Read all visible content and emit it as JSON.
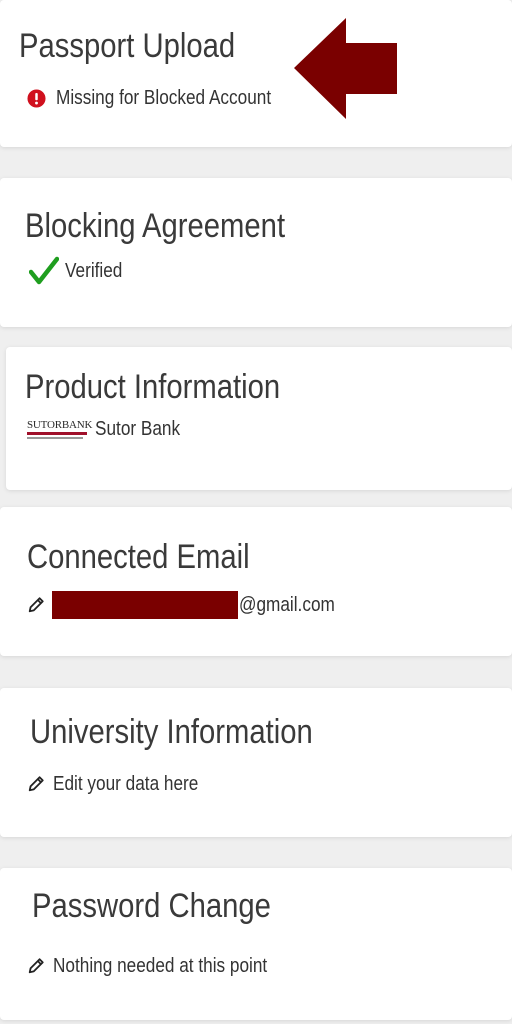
{
  "colors": {
    "error_red": "#d0101e",
    "verified_green": "#1f9e1f",
    "arrow_maroon": "#7a0000",
    "redaction_maroon": "#7a0000",
    "logo_red": "#a0102a"
  },
  "cards": {
    "passport": {
      "title": "Passport Upload",
      "status_icon": "error-circle-icon",
      "status": "Missing for Blocked Account"
    },
    "blocking": {
      "title": "Blocking Agreement",
      "status_icon": "checkmark-icon",
      "status": "Verified"
    },
    "product": {
      "title": "Product Information",
      "logo_text": "SUTORBANK",
      "bank_name": "Sutor Bank"
    },
    "email": {
      "title": "Connected Email",
      "status_icon": "pencil-icon",
      "email_domain": "@gmail.com"
    },
    "university": {
      "title": "University Information",
      "status_icon": "pencil-icon",
      "status": "Edit your data here"
    },
    "password": {
      "title": "Password Change",
      "status_icon": "pencil-icon",
      "status": "Nothing needed at this point"
    }
  },
  "annotation": {
    "icon": "left-arrow-icon"
  }
}
